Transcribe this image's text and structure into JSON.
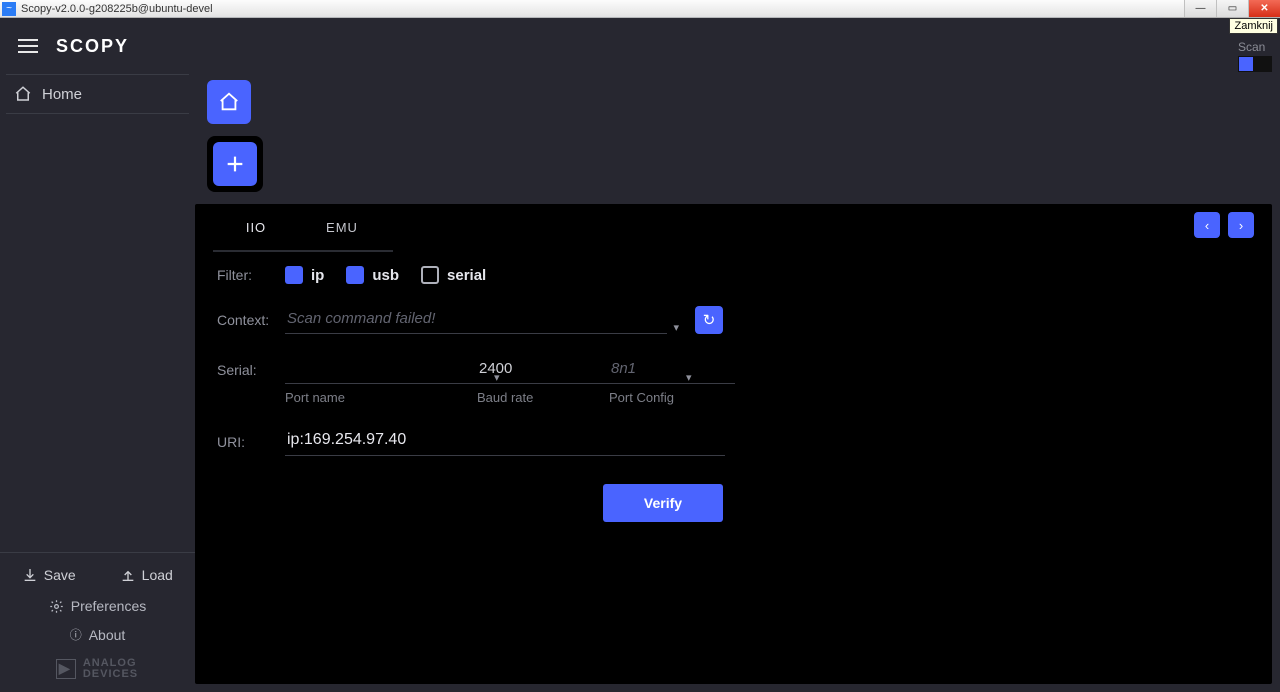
{
  "window": {
    "title": "Scopy-v2.0.0-g208225b@ubuntu-devel",
    "close_tooltip": "Zamknij"
  },
  "header": {
    "logo": "SCOPY",
    "scan_label": "Scan",
    "scan_on": true
  },
  "sidebar": {
    "home": "Home",
    "save": "Save",
    "load": "Load",
    "preferences": "Preferences",
    "about": "About",
    "vendor_line1": "ANALOG",
    "vendor_line2": "DEVICES"
  },
  "panel": {
    "tabs": [
      {
        "id": "iio",
        "label": "IIO",
        "active": true
      },
      {
        "id": "emu",
        "label": "EMU",
        "active": false
      }
    ],
    "filter": {
      "label": "Filter:",
      "options": [
        {
          "id": "ip",
          "label": "ip",
          "checked": true
        },
        {
          "id": "usb",
          "label": "usb",
          "checked": true
        },
        {
          "id": "serial",
          "label": "serial",
          "checked": false
        }
      ]
    },
    "context": {
      "label": "Context:",
      "value": "",
      "placeholder": "Scan command failed!"
    },
    "serial": {
      "label": "Serial:",
      "port_name": {
        "value": "",
        "sublabel": "Port name"
      },
      "baud_rate": {
        "value": "2400",
        "sublabel": "Baud rate"
      },
      "port_config": {
        "value": "",
        "placeholder": "8n1",
        "sublabel": "Port Config"
      }
    },
    "uri": {
      "label": "URI:",
      "value": "ip:169.254.97.40"
    },
    "verify_label": "Verify"
  }
}
